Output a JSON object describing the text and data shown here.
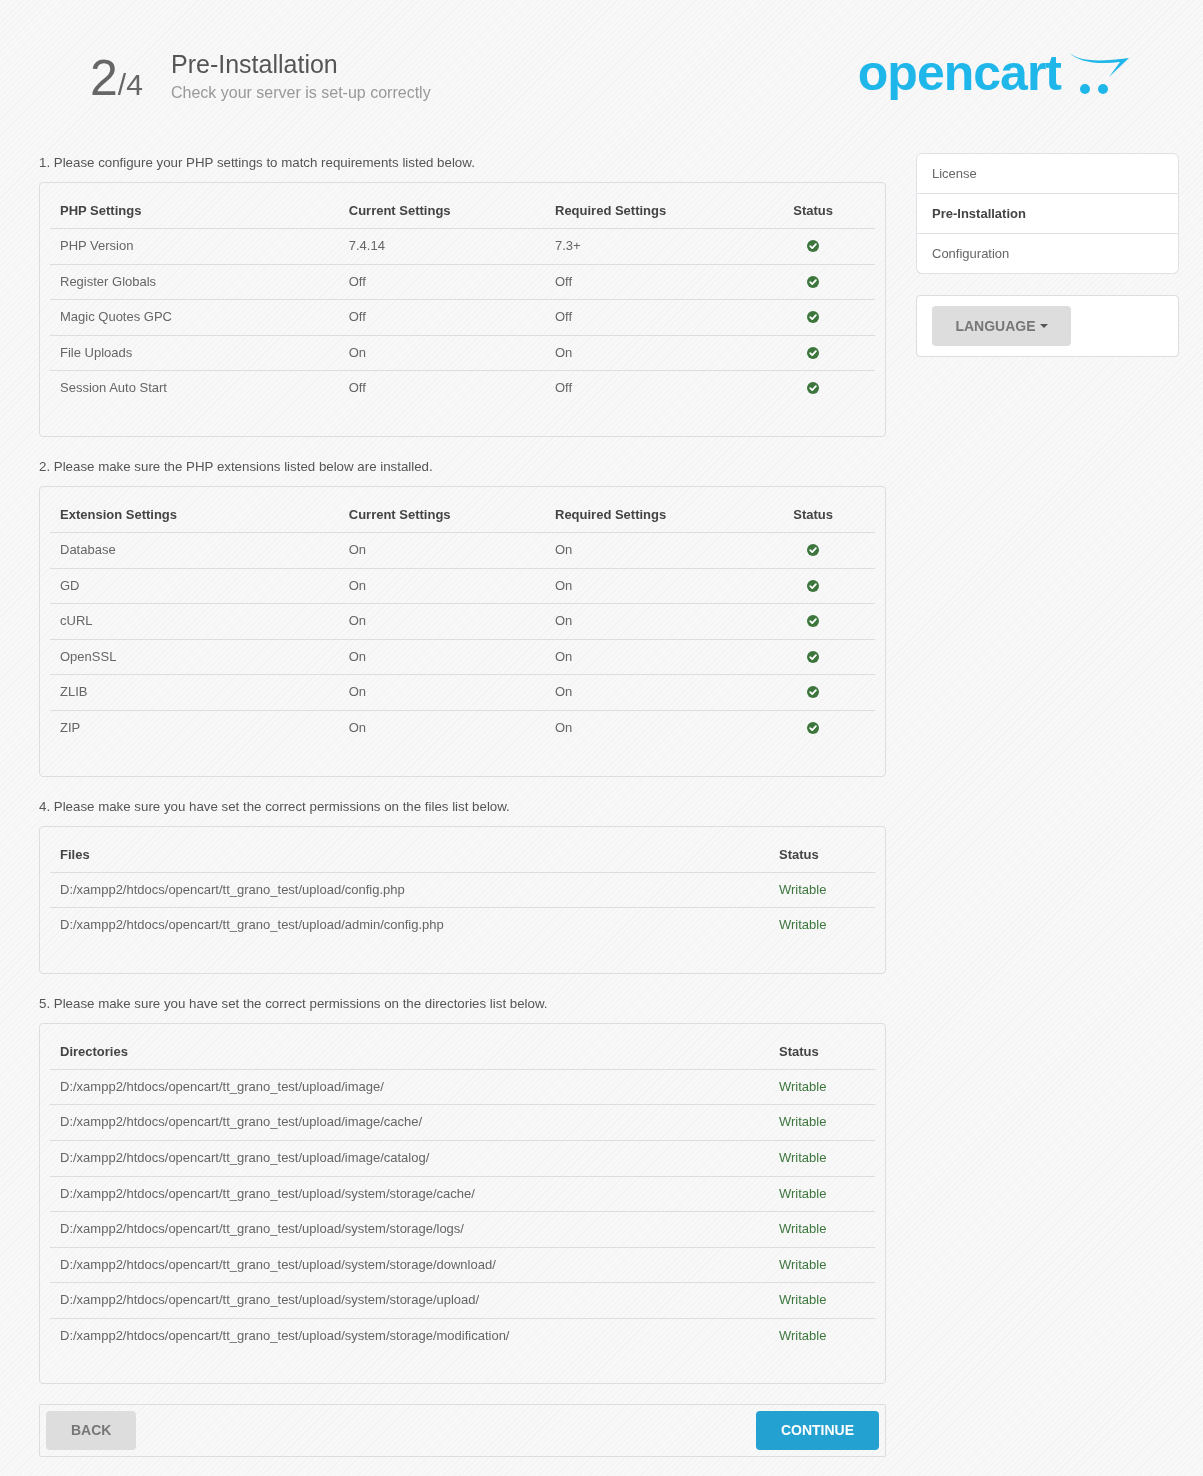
{
  "header": {
    "step_current": "2",
    "step_total": "/4",
    "title": "Pre-Installation",
    "subtitle": "Check your server is set-up correctly",
    "logo": "opencart"
  },
  "sections": [
    {
      "kind": "settings",
      "intro": "1. Please configure your PHP settings to match requirements listed below.",
      "columns": [
        "PHP Settings",
        "Current Settings",
        "Required Settings",
        "Status"
      ],
      "rows": [
        {
          "name": "PHP Version",
          "current": "7.4.14",
          "required": "7.3+",
          "passed": true
        },
        {
          "name": "Register Globals",
          "current": "Off",
          "required": "Off",
          "passed": true
        },
        {
          "name": "Magic Quotes GPC",
          "current": "Off",
          "required": "Off",
          "passed": true
        },
        {
          "name": "File Uploads",
          "current": "On",
          "required": "On",
          "passed": true
        },
        {
          "name": "Session Auto Start",
          "current": "Off",
          "required": "Off",
          "passed": true
        }
      ]
    },
    {
      "kind": "settings",
      "intro": "2. Please make sure the PHP extensions listed below are installed.",
      "columns": [
        "Extension Settings",
        "Current Settings",
        "Required Settings",
        "Status"
      ],
      "rows": [
        {
          "name": "Database",
          "current": "On",
          "required": "On",
          "passed": true
        },
        {
          "name": "GD",
          "current": "On",
          "required": "On",
          "passed": true
        },
        {
          "name": "cURL",
          "current": "On",
          "required": "On",
          "passed": true
        },
        {
          "name": "OpenSSL",
          "current": "On",
          "required": "On",
          "passed": true
        },
        {
          "name": "ZLIB",
          "current": "On",
          "required": "On",
          "passed": true
        },
        {
          "name": "ZIP",
          "current": "On",
          "required": "On",
          "passed": true
        }
      ]
    },
    {
      "kind": "permissions",
      "intro": "4. Please make sure you have set the correct permissions on the files list below.",
      "columns": [
        "Files",
        "Status"
      ],
      "rows": [
        {
          "path": "D:/xampp2/htdocs/opencart/tt_grano_test/upload/config.php",
          "status": "Writable",
          "writable": true
        },
        {
          "path": "D:/xampp2/htdocs/opencart/tt_grano_test/upload/admin/config.php",
          "status": "Writable",
          "writable": true
        }
      ]
    },
    {
      "kind": "permissions",
      "intro": "5. Please make sure you have set the correct permissions on the directories list below.",
      "columns": [
        "Directories",
        "Status"
      ],
      "rows": [
        {
          "path": "D:/xampp2/htdocs/opencart/tt_grano_test/upload/image/",
          "status": "Writable",
          "writable": true
        },
        {
          "path": "D:/xampp2/htdocs/opencart/tt_grano_test/upload/image/cache/",
          "status": "Writable",
          "writable": true
        },
        {
          "path": "D:/xampp2/htdocs/opencart/tt_grano_test/upload/image/catalog/",
          "status": "Writable",
          "writable": true
        },
        {
          "path": "D:/xampp2/htdocs/opencart/tt_grano_test/upload/system/storage/cache/",
          "status": "Writable",
          "writable": true
        },
        {
          "path": "D:/xampp2/htdocs/opencart/tt_grano_test/upload/system/storage/logs/",
          "status": "Writable",
          "writable": true
        },
        {
          "path": "D:/xampp2/htdocs/opencart/tt_grano_test/upload/system/storage/download/",
          "status": "Writable",
          "writable": true
        },
        {
          "path": "D:/xampp2/htdocs/opencart/tt_grano_test/upload/system/storage/upload/",
          "status": "Writable",
          "writable": true
        },
        {
          "path": "D:/xampp2/htdocs/opencart/tt_grano_test/upload/system/storage/modification/",
          "status": "Writable",
          "writable": true
        }
      ]
    }
  ],
  "footer": {
    "back": "BACK",
    "continue": "CONTINUE"
  },
  "sidebar": {
    "steps": [
      {
        "label": "License",
        "selected": false
      },
      {
        "label": "Pre-Installation",
        "selected": true
      },
      {
        "label": "Configuration",
        "selected": false
      }
    ],
    "language_button": "LANGUAGE"
  }
}
